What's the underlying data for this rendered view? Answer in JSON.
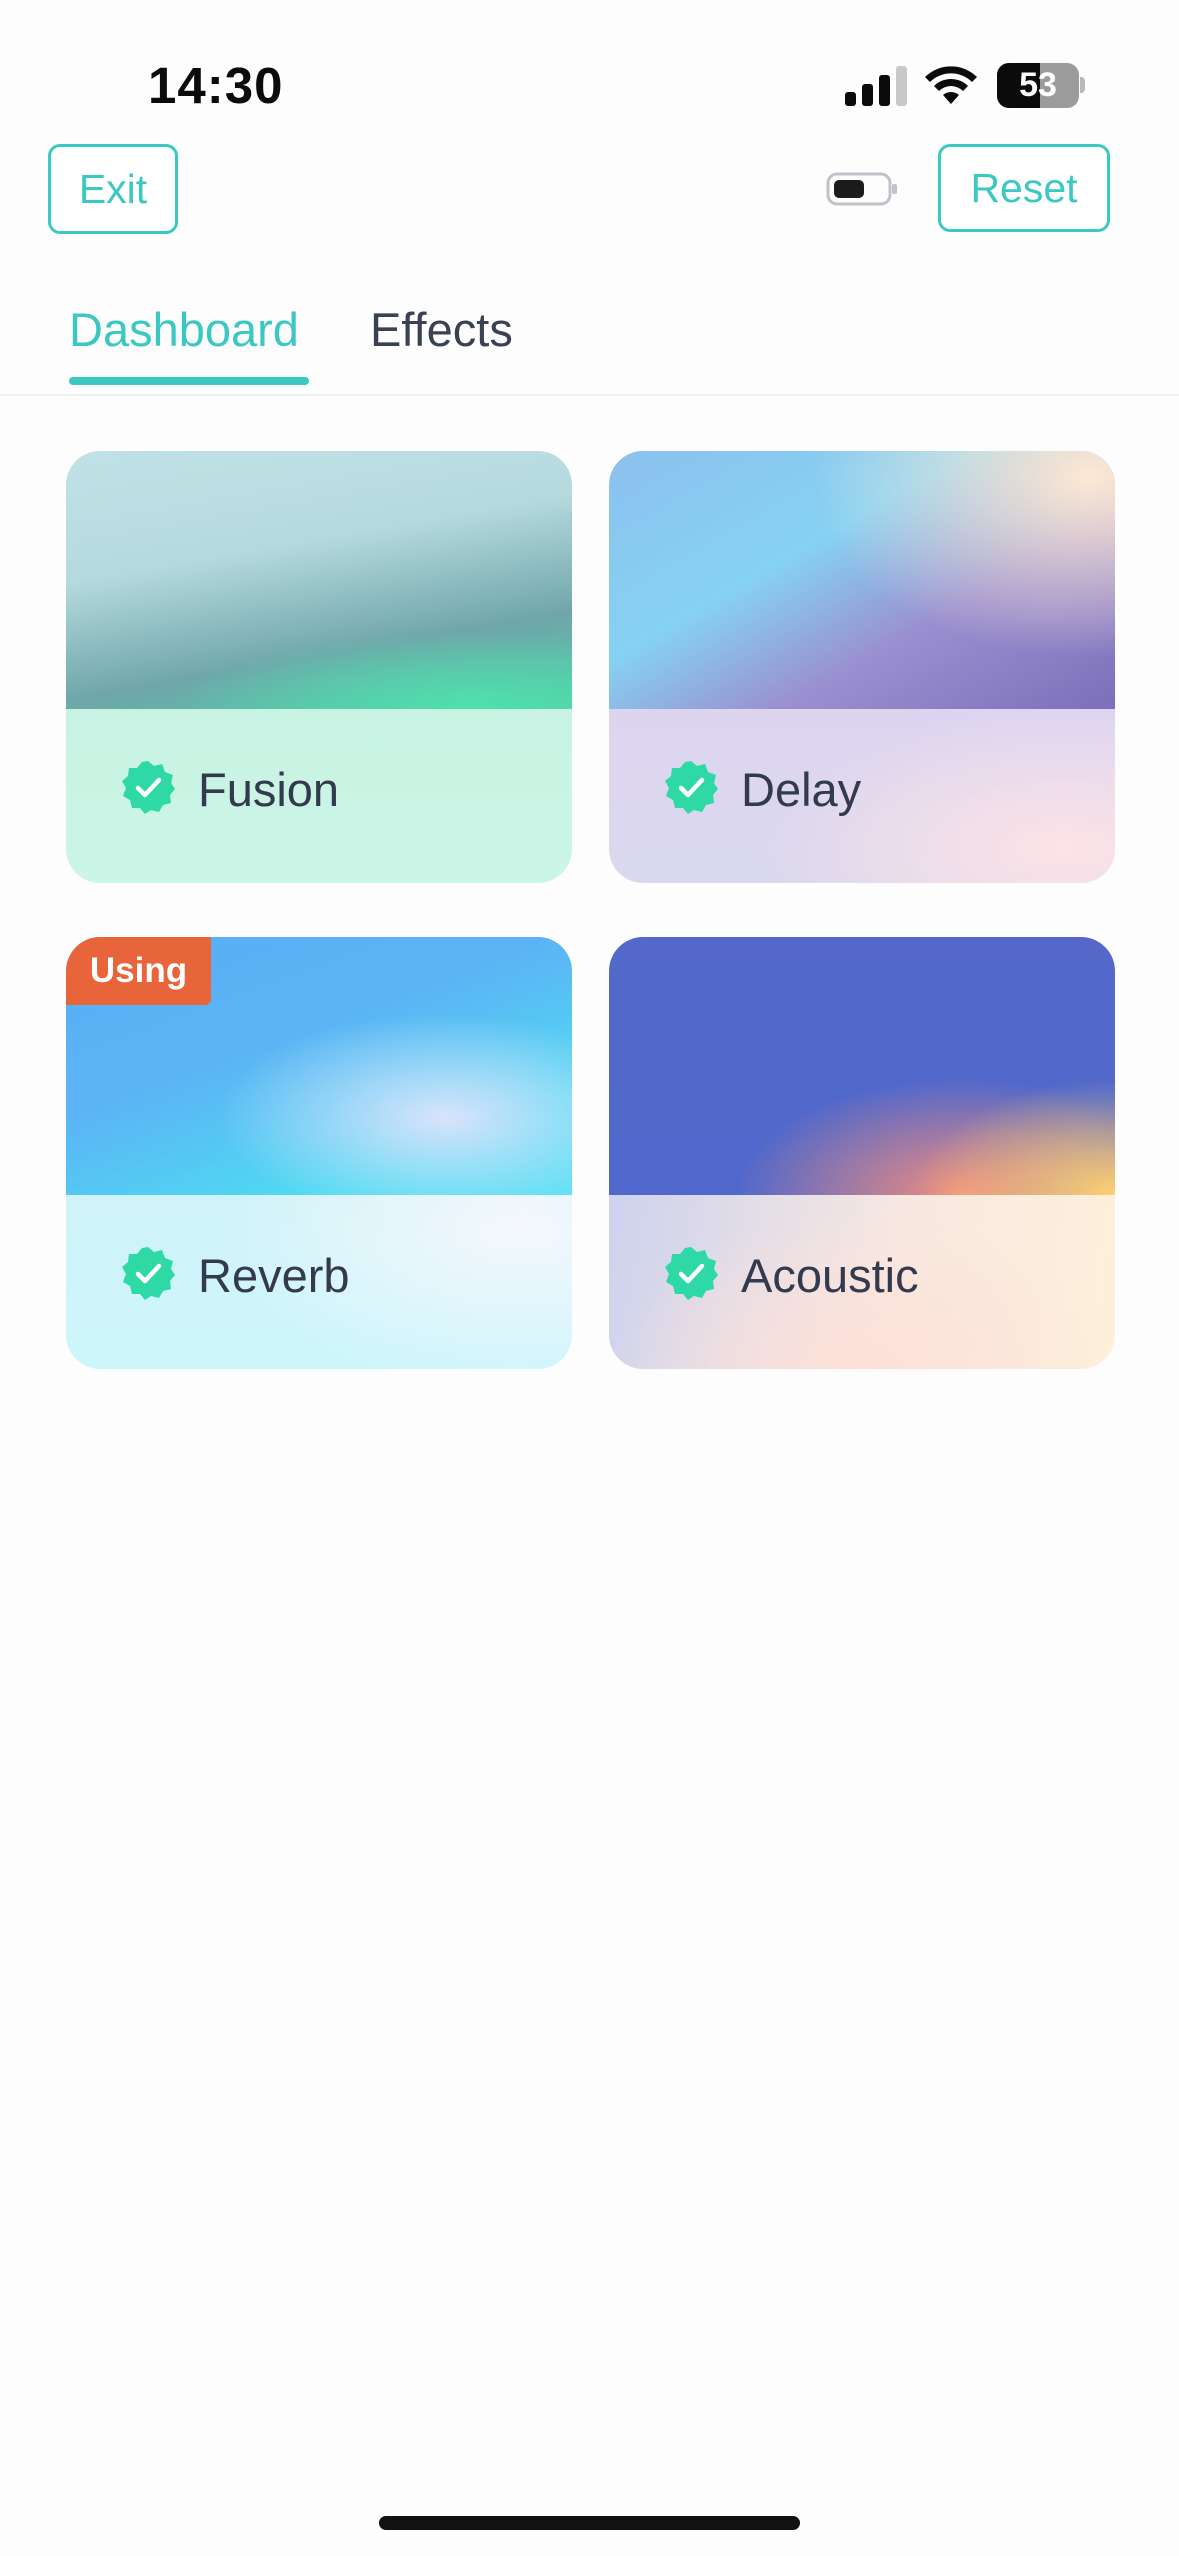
{
  "status_bar": {
    "time": "14:30",
    "battery_percent": "53"
  },
  "header": {
    "exit_label": "Exit",
    "reset_label": "Reset"
  },
  "tabs": [
    {
      "label": "Dashboard",
      "active": true
    },
    {
      "label": "Effects",
      "active": false
    }
  ],
  "presets": [
    {
      "name": "Fusion",
      "selected": true
    },
    {
      "name": "Delay",
      "selected": true
    },
    {
      "name": "Reverb",
      "selected": true,
      "tag": "Using"
    },
    {
      "name": "Acoustic",
      "selected": true
    }
  ],
  "colors": {
    "accent": "#3cc8c2",
    "check_badge": "#2ed9a6",
    "using_tag": "#e8643a"
  }
}
